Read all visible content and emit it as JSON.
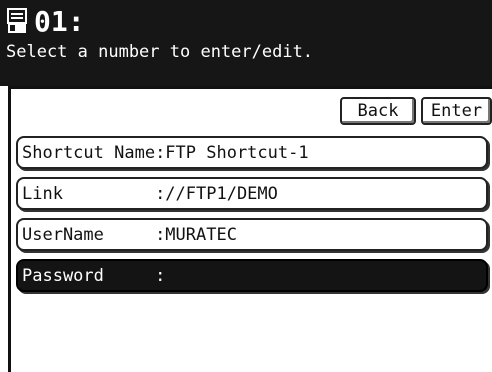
{
  "header": {
    "code": "01:",
    "subtitle": "Select a number to enter/edit.",
    "icon": "fax-machine-icon"
  },
  "buttons": {
    "back": "Back",
    "enter": "Enter"
  },
  "fields": [
    {
      "label": "Shortcut Name",
      "value": ":FTP Shortcut-1"
    },
    {
      "label": "Link         ",
      "value": "://FTP1/DEMO"
    },
    {
      "label": "UserName     ",
      "value": ":MURATEC"
    },
    {
      "label": "Password     ",
      "value": ":"
    }
  ],
  "colors": {
    "header_bg": "#161616",
    "selected_bg": "#141414"
  }
}
